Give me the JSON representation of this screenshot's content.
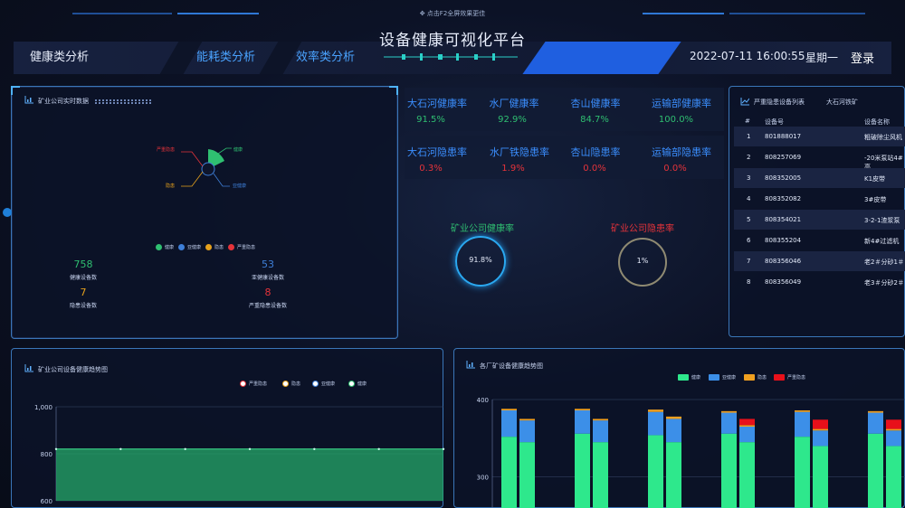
{
  "header": {
    "hint": "点击F2全屏效果更佳",
    "title": "设备健康可视化平台",
    "tabs": [
      "健康类分析",
      "能耗类分析",
      "效率类分析"
    ],
    "datetime": "2022-07-11 16:00:55",
    "weekday": "星期一",
    "login": "登录"
  },
  "left_panel": {
    "title": "矿业公司实时数据",
    "donut_labels": {
      "severe": "严重隐患",
      "healthy": "健康",
      "hidden": "隐患",
      "subhealthy": "亚健康"
    },
    "legend": [
      "健康",
      "亚健康",
      "隐患",
      "严重隐患"
    ],
    "stats": [
      {
        "value": "758",
        "label": "健康设备数",
        "color": "#2fbf71"
      },
      {
        "value": "53",
        "label": "亚健康设备数",
        "color": "#3e7fd8"
      },
      {
        "value": "7",
        "label": "隐患设备数",
        "color": "#e6a11c"
      },
      {
        "value": "8",
        "label": "严重隐患设备数",
        "color": "#e5333a"
      }
    ]
  },
  "rates": {
    "health": [
      {
        "label": "大石河健康率",
        "value": "91.5%"
      },
      {
        "label": "水厂健康率",
        "value": "92.9%"
      },
      {
        "label": "杏山健康率",
        "value": "84.7%"
      },
      {
        "label": "运输部健康率",
        "value": "100.0%"
      }
    ],
    "hazard": [
      {
        "label": "大石河隐患率",
        "value": "0.3%"
      },
      {
        "label": "水厂铁隐患率",
        "value": "1.9%"
      },
      {
        "label": "杏山隐患率",
        "value": "0.0%"
      },
      {
        "label": "运输部隐患率",
        "value": "0.0%"
      }
    ],
    "company_health_label": "矿业公司健康率",
    "company_health_value": "91.8%",
    "company_hazard_label": "矿业公司隐患率",
    "company_hazard_value": "1%"
  },
  "right_panel": {
    "title": "严重隐患设备列表",
    "filter": "大石河铁矿",
    "columns": [
      "#",
      "设备号",
      "设备名称"
    ],
    "rows": [
      [
        "1",
        "801888017",
        "粗破除尘风机"
      ],
      [
        "2",
        "808257069",
        "-20米泵站4#高"
      ],
      [
        "3",
        "808352005",
        "K1皮带"
      ],
      [
        "4",
        "808352082",
        "3#皮带"
      ],
      [
        "5",
        "808354021",
        "3-2-1渣浆泵"
      ],
      [
        "6",
        "808355204",
        "新4#过滤机"
      ],
      [
        "7",
        "808356046",
        "老2＃分砂1＃"
      ],
      [
        "8",
        "808356049",
        "老3＃分砂2＃"
      ]
    ]
  },
  "bottom_left": {
    "title": "矿业公司设备健康趋势图",
    "legend": [
      "严重隐患",
      "隐患",
      "亚健康",
      "健康"
    ]
  },
  "bottom_right": {
    "title": "各厂矿设备健康趋势图",
    "legend": [
      "健康",
      "亚健康",
      "隐患",
      "严重隐患"
    ]
  },
  "chart_data": [
    {
      "type": "area",
      "ylim": [
        600,
        1000
      ],
      "y_ticks": [
        "1,000",
        "800",
        "600"
      ],
      "legend": [
        "严重隐患",
        "隐患",
        "亚健康",
        "健康"
      ],
      "series": [
        {
          "name": "健康",
          "values": [
            820,
            820,
            820,
            820,
            820,
            820,
            820
          ]
        }
      ]
    },
    {
      "type": "bar",
      "ylim": [
        260,
        400
      ],
      "y_ticks": [
        "400",
        "300"
      ],
      "legend": [
        "健康",
        "亚健康",
        "隐患",
        "严重隐患"
      ],
      "groups": [
        [
          [
            352,
            34,
            2,
            0
          ],
          [
            345,
            28,
            2,
            0
          ]
        ],
        [
          [
            356,
            30,
            2,
            0
          ],
          [
            345,
            28,
            2,
            0
          ]
        ],
        [
          [
            354,
            30,
            3,
            0
          ],
          [
            345,
            30,
            3,
            0
          ]
        ],
        [
          [
            356,
            27,
            2,
            0
          ],
          [
            345,
            20,
            2,
            8
          ]
        ],
        [
          [
            352,
            32,
            2,
            0
          ],
          [
            340,
            20,
            2,
            12
          ]
        ],
        [
          [
            356,
            27,
            2,
            0
          ],
          [
            340,
            20,
            2,
            12
          ]
        ]
      ]
    }
  ],
  "colors": {
    "healthy": "#2ee88c",
    "subhealthy": "#3c8fe8",
    "hidden": "#f0a020",
    "severe": "#e8101a",
    "accent": "#1f5fe0"
  }
}
